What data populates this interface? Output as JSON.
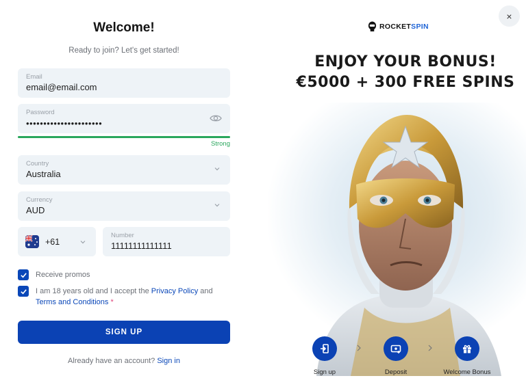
{
  "form": {
    "title": "Welcome!",
    "subtitle": "Ready to join? Let's get started!",
    "email": {
      "label": "Email",
      "value": "email@email.com"
    },
    "password": {
      "label": "Password",
      "masked_value": "••••••••••••••••••••••",
      "strength": "Strong",
      "strength_level": 1.0
    },
    "country": {
      "label": "Country",
      "value": "Australia"
    },
    "currency": {
      "label": "Currency",
      "value": "AUD"
    },
    "phone": {
      "code": "+61",
      "number_label": "Number",
      "number_value": "11111111111111"
    },
    "promos_label": "Receive promos",
    "terms": {
      "prefix": "I am 18 years old and I accept the ",
      "privacy_link": "Privacy Policy",
      "and": " and",
      "terms_link": "Terms and Conditions",
      "required_mark": " *"
    },
    "signup_button": "SIGN UP",
    "signin_prompt": "Already have an account? ",
    "signin_link": "Sign in"
  },
  "promo": {
    "logo": {
      "part1": "ROCKET",
      "part2": "SPIN"
    },
    "close": "×",
    "headline_line1": "ENJOY YOUR BONUS!",
    "headline_line2": "€5000 + 300 FREE SPINS",
    "steps": [
      {
        "label": "Sign up",
        "icon": "login-icon"
      },
      {
        "label": "Deposit",
        "icon": "deposit-icon"
      },
      {
        "label": "Welcome Bonus",
        "icon": "gift-icon"
      }
    ],
    "step_separator": "chevron-right-icon"
  },
  "colors": {
    "primary": "#0b42b4",
    "strength": "#29a65c",
    "field_bg": "#eef3f7",
    "link": "#0a47b8"
  }
}
